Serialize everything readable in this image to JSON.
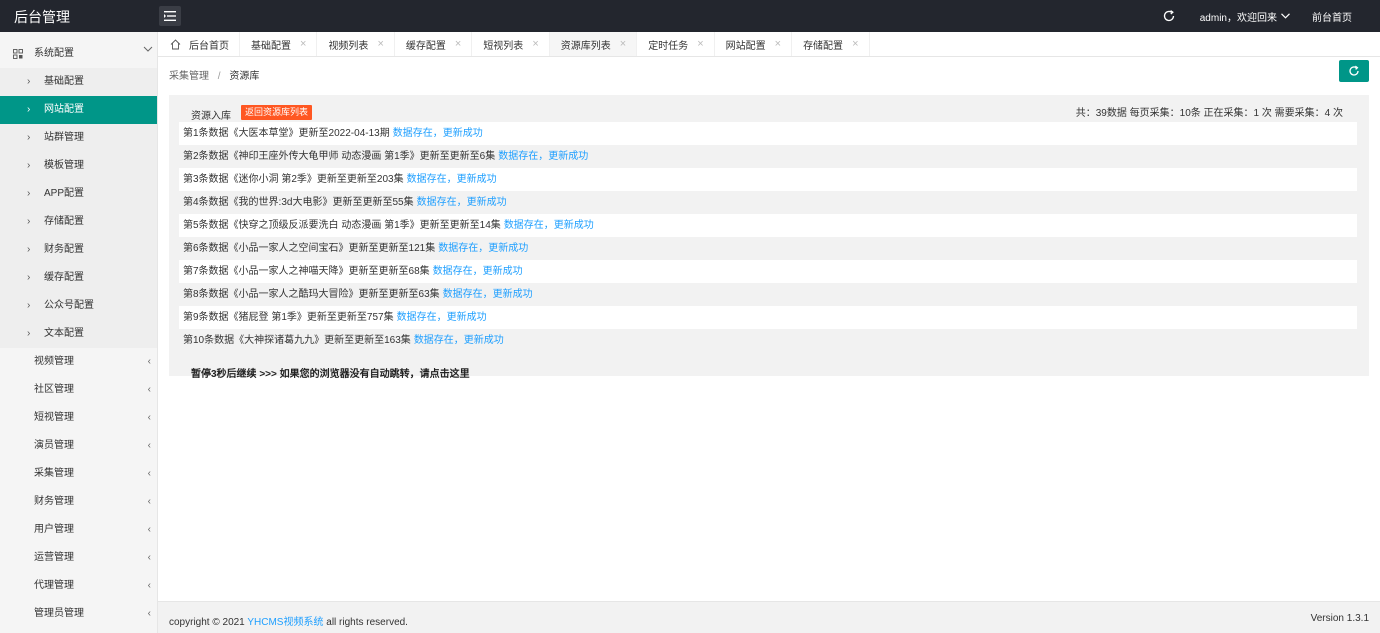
{
  "header": {
    "brand": "后台管理",
    "user": "admin，欢迎回来",
    "front_link": "前台首页"
  },
  "sidebar": {
    "system_config": "系统配置",
    "sub_items": [
      {
        "label": "基础配置"
      },
      {
        "label": "网站配置",
        "active": true
      },
      {
        "label": "站群管理"
      },
      {
        "label": "模板管理"
      },
      {
        "label": "APP配置"
      },
      {
        "label": "存储配置"
      },
      {
        "label": "财务配置"
      },
      {
        "label": "缓存配置"
      },
      {
        "label": "公众号配置"
      },
      {
        "label": "文本配置"
      }
    ],
    "groups": [
      {
        "label": "视频管理",
        "icon": "video-icon"
      },
      {
        "label": "社区管理",
        "icon": "hand-icon"
      },
      {
        "label": "短视管理",
        "icon": "play-icon"
      },
      {
        "label": "演员管理",
        "icon": "flag-icon"
      },
      {
        "label": "采集管理",
        "icon": "send-icon"
      },
      {
        "label": "财务管理",
        "icon": "money-icon"
      },
      {
        "label": "用户管理",
        "icon": "user-icon"
      },
      {
        "label": "运营管理",
        "icon": "target-icon"
      },
      {
        "label": "代理管理",
        "icon": "diamond-icon"
      },
      {
        "label": "管理员管理",
        "icon": "admin-icon"
      }
    ]
  },
  "tabs": [
    {
      "label": "后台首页",
      "home": true
    },
    {
      "label": "基础配置"
    },
    {
      "label": "视频列表"
    },
    {
      "label": "缓存配置"
    },
    {
      "label": "短视列表"
    },
    {
      "label": "资源库列表",
      "active": true
    },
    {
      "label": "定时任务"
    },
    {
      "label": "网站配置"
    },
    {
      "label": "存储配置"
    }
  ],
  "breadcrumb": {
    "parent": "采集管理",
    "separator": "/",
    "current": "资源库"
  },
  "panel": {
    "title": "资源入库",
    "return_button": "返回资源库列表",
    "stats": "共：39数据 每页采集：10条 正在采集：1 次 需要采集：4 次",
    "rows": [
      {
        "text": "第1条数据《大医本草堂》更新至2022-04-13期",
        "status": "数据存在，更新成功"
      },
      {
        "text": "第2条数据《神印王座外传大龟甲师 动态漫画 第1季》更新至更新至6集",
        "status": "数据存在，更新成功"
      },
      {
        "text": "第3条数据《迷你小洞 第2季》更新至更新至203集",
        "status": "数据存在，更新成功"
      },
      {
        "text": "第4条数据《我的世界:3d大电影》更新至更新至55集",
        "status": "数据存在，更新成功"
      },
      {
        "text": "第5条数据《快穿之顶级反派要洗白 动态漫画 第1季》更新至更新至14集",
        "status": "数据存在，更新成功"
      },
      {
        "text": "第6条数据《小品一家人之空间宝石》更新至更新至121集",
        "status": "数据存在，更新成功"
      },
      {
        "text": "第7条数据《小品一家人之神喵天降》更新至更新至68集",
        "status": "数据存在，更新成功"
      },
      {
        "text": "第8条数据《小品一家人之酷玛大冒险》更新至更新至63集",
        "status": "数据存在，更新成功"
      },
      {
        "text": "第9条数据《猪屁登 第1季》更新至更新至757集",
        "status": "数据存在，更新成功"
      },
      {
        "text": "第10条数据《大神探诸葛九九》更新至更新至163集",
        "status": "数据存在，更新成功"
      }
    ],
    "pause_text": "暂停3秒后继续 >>> 如果您的浏览器没有自动跳转，请点击这里"
  },
  "footer": {
    "copyright_pre": "copyright © 2021",
    "copyright_brand": "YHCMS视频系统",
    "copyright_post": "all rights reserved.",
    "version": "Version 1.3.1"
  },
  "colors": {
    "header_bg": "#23262e",
    "accent": "#009688",
    "danger": "#ff5722",
    "link": "#1e9fff"
  }
}
